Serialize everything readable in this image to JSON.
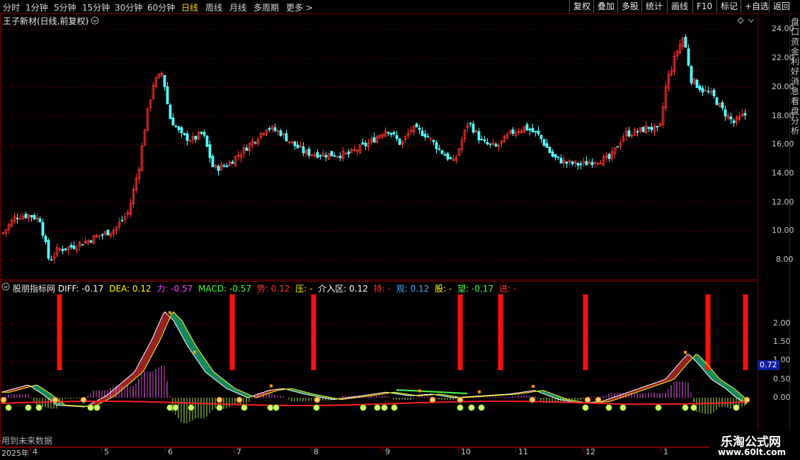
{
  "toolbar": {
    "periods": [
      "分时",
      "1分钟",
      "5分钟",
      "15分钟",
      "30分钟",
      "60分钟",
      "日线",
      "周线",
      "月线",
      "多周期",
      "更多 >"
    ],
    "active_period": "日线",
    "actions": [
      "复权",
      "叠加",
      "多股",
      "统计",
      "画线",
      "F10",
      "标记",
      "+自选",
      "返回"
    ]
  },
  "main_chart": {
    "title": "王子新材(日线,前复权)",
    "y_ticks": [
      "24.00",
      "22.00",
      "20.00",
      "18.00",
      "16.00",
      "14.00",
      "12.00",
      "10.00",
      "8.00"
    ],
    "right_panel_text": "盘口资金利好消息看盘分析"
  },
  "indicator": {
    "name": "股朋指标网",
    "values": [
      {
        "label": "DIFF:",
        "value": "-0.17",
        "color": "#ffffff"
      },
      {
        "label": "DEA:",
        "value": "0.12",
        "color": "#ffff00"
      },
      {
        "label": "力:",
        "value": "-0.57",
        "color": "#ff44ff"
      },
      {
        "label": "MACD:",
        "value": "-0.57",
        "color": "#44ff44"
      },
      {
        "label": "势:",
        "value": "0.12",
        "color": "#ff3333"
      },
      {
        "label": "压:",
        "value": "-",
        "color": "#ffff00"
      },
      {
        "label": "介入区:",
        "value": "0.12",
        "color": "#ffffff"
      },
      {
        "label": "持:",
        "value": "-",
        "color": "#ff3333"
      },
      {
        "label": "观:",
        "value": "0.12",
        "color": "#44aaff"
      },
      {
        "label": "股:",
        "value": "-",
        "color": "#ffff00"
      },
      {
        "label": "望:",
        "value": "-0.17",
        "color": "#44ff44"
      },
      {
        "label": "进:",
        "value": "-",
        "color": "#ff3333"
      }
    ],
    "y_ticks": [
      "2.00",
      "1.50",
      "1.00",
      "0.50",
      "0.00"
    ],
    "current_badge": "0.72",
    "footer_note": "用到未来数据"
  },
  "date_axis": {
    "labels": [
      "2025年",
      "4",
      "5",
      "6",
      "7",
      "8",
      "9",
      "10",
      "11",
      "12",
      "1"
    ]
  },
  "watermark": {
    "title": "乐淘公式网",
    "url": "www.60lt.com"
  },
  "colors": {
    "up": "#ff3232",
    "down": "#54ffff",
    "grid": "#7a0000"
  }
}
